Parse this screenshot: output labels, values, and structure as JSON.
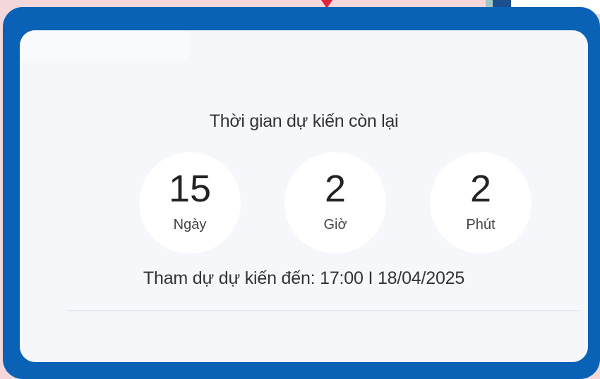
{
  "countdown": {
    "heading": "Thời gian dự kiến còn lại",
    "days": {
      "value": "15",
      "label": "Ngày"
    },
    "hours": {
      "value": "2",
      "label": "Giờ"
    },
    "minutes": {
      "value": "2",
      "label": "Phút"
    },
    "eta": "Tham dự dự kiến đến: 17:00 I 18/04/2025"
  },
  "colors": {
    "frame": "#0a62b6",
    "card": "#f5f7fa",
    "circle": "#ffffff",
    "marker": "#e0233a"
  }
}
